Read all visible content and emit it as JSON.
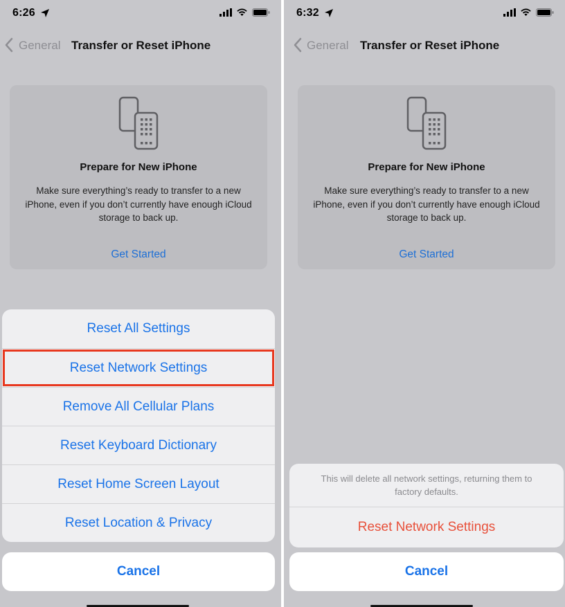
{
  "left": {
    "status": {
      "time": "6:26",
      "icons": [
        "location-arrow-icon",
        "signal-icon",
        "wifi-icon",
        "battery-icon"
      ]
    },
    "nav": {
      "back_label": "General",
      "title": "Transfer or Reset iPhone"
    },
    "card": {
      "title": "Prepare for New iPhone",
      "description": "Make sure everything’s ready to transfer to a new iPhone, even if you don’t currently have enough iCloud storage to back up.",
      "link": "Get Started"
    },
    "sheet": {
      "items": [
        {
          "label": "Reset All Settings",
          "highlighted": false
        },
        {
          "label": "Reset Network Settings",
          "highlighted": true
        },
        {
          "label": "Remove All Cellular Plans",
          "highlighted": false
        },
        {
          "label": "Reset Keyboard Dictionary",
          "highlighted": false
        },
        {
          "label": "Reset Home Screen Layout",
          "highlighted": false
        },
        {
          "label": "Reset Location & Privacy",
          "highlighted": false
        }
      ],
      "cancel": "Cancel"
    }
  },
  "right": {
    "status": {
      "time": "6:32",
      "icons": [
        "location-arrow-icon",
        "signal-icon",
        "wifi-icon",
        "battery-icon"
      ]
    },
    "nav": {
      "back_label": "General",
      "title": "Transfer or Reset iPhone"
    },
    "card": {
      "title": "Prepare for New iPhone",
      "description": "Make sure everything’s ready to transfer to a new iPhone, even if you don’t currently have enough iCloud storage to back up.",
      "link": "Get Started"
    },
    "confirm": {
      "message": "This will delete all network settings, returning them to factory defaults.",
      "action": "Reset Network Settings",
      "cancel": "Cancel"
    }
  },
  "colors": {
    "accent": "#1a73e8",
    "destructive": "#e8503a",
    "highlight": "#e8381f"
  }
}
